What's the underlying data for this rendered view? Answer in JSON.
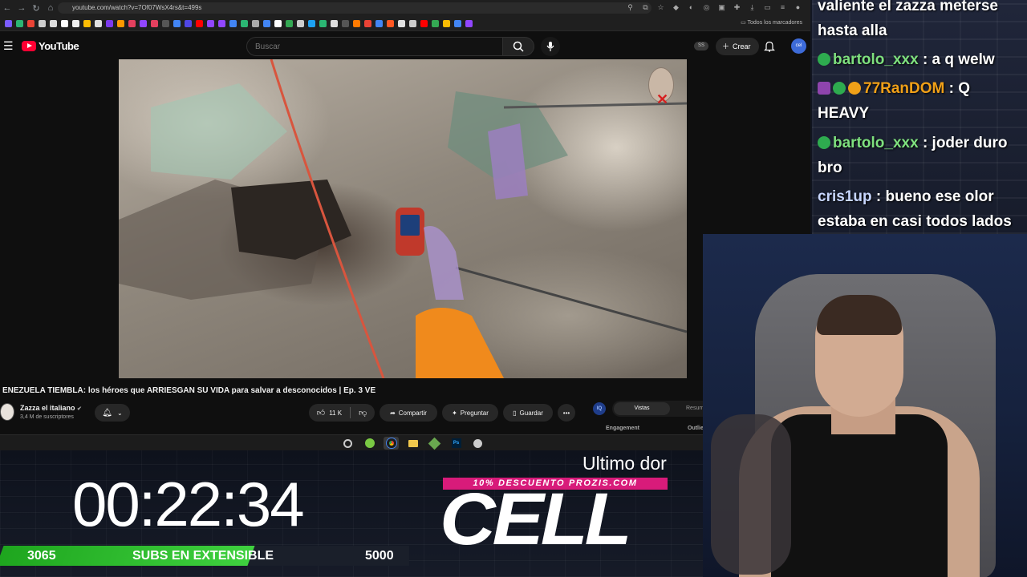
{
  "browser": {
    "url": "youtube.com/watch?v=7Of07WsX4rs&t=499s",
    "all_bookmarks_label": "Todos los marcadores"
  },
  "youtube": {
    "logo_text": "YouTube",
    "search_placeholder": "Buscar",
    "ss_badge": "SS",
    "create_label": "Crear",
    "avatar_label": "cel"
  },
  "video": {
    "title": "ENEZUELA TIEMBLA: los héroes que ARRIESGAN SU VIDA para salvar a desconocidos | Ep. 3 VE",
    "channel_name": "Zazza el italiano",
    "channel_subs": "3,4 M de suscriptores",
    "likes": "11 K",
    "share_label": "Compartir",
    "ask_label": "Preguntar",
    "save_label": "Guardar"
  },
  "side_panel": {
    "icon_label": "IQ",
    "tab_active": "Vistas",
    "tab_other": "Resum",
    "label_engagement": "Engagement",
    "label_outlier": "Outlie"
  },
  "overlay": {
    "timer": "00:22:34",
    "subs_current": "3065",
    "subs_label": "SUBS EN EXTENSIBLE",
    "subs_goal": "5000",
    "subs_progress": 0.613,
    "last_donation_label": "Ultimo dor",
    "promo_text": "10% DESCUENTO PROZIS.COM",
    "donor_name": "CELL"
  },
  "chat": {
    "messages": [
      {
        "user": "",
        "text": "valiente el zazza meterse hasta alla"
      },
      {
        "user": "bartolo_xxx",
        "text": ": a q welw"
      },
      {
        "user": "77RanDOM",
        "text": ": Q HEAVY"
      },
      {
        "user": "bartolo_xxx",
        "text": ": joder duro bro"
      },
      {
        "user": "cris1up",
        "text": ": bueno ese olor estaba en casi todos lados"
      }
    ]
  },
  "colors": {
    "youtube_red": "#ff0033",
    "progress_green": "#3fd13f",
    "promo_pink": "#d81b7a",
    "chat_user_green": "#7ee07e",
    "chat_user_orange": "#f0a018"
  }
}
